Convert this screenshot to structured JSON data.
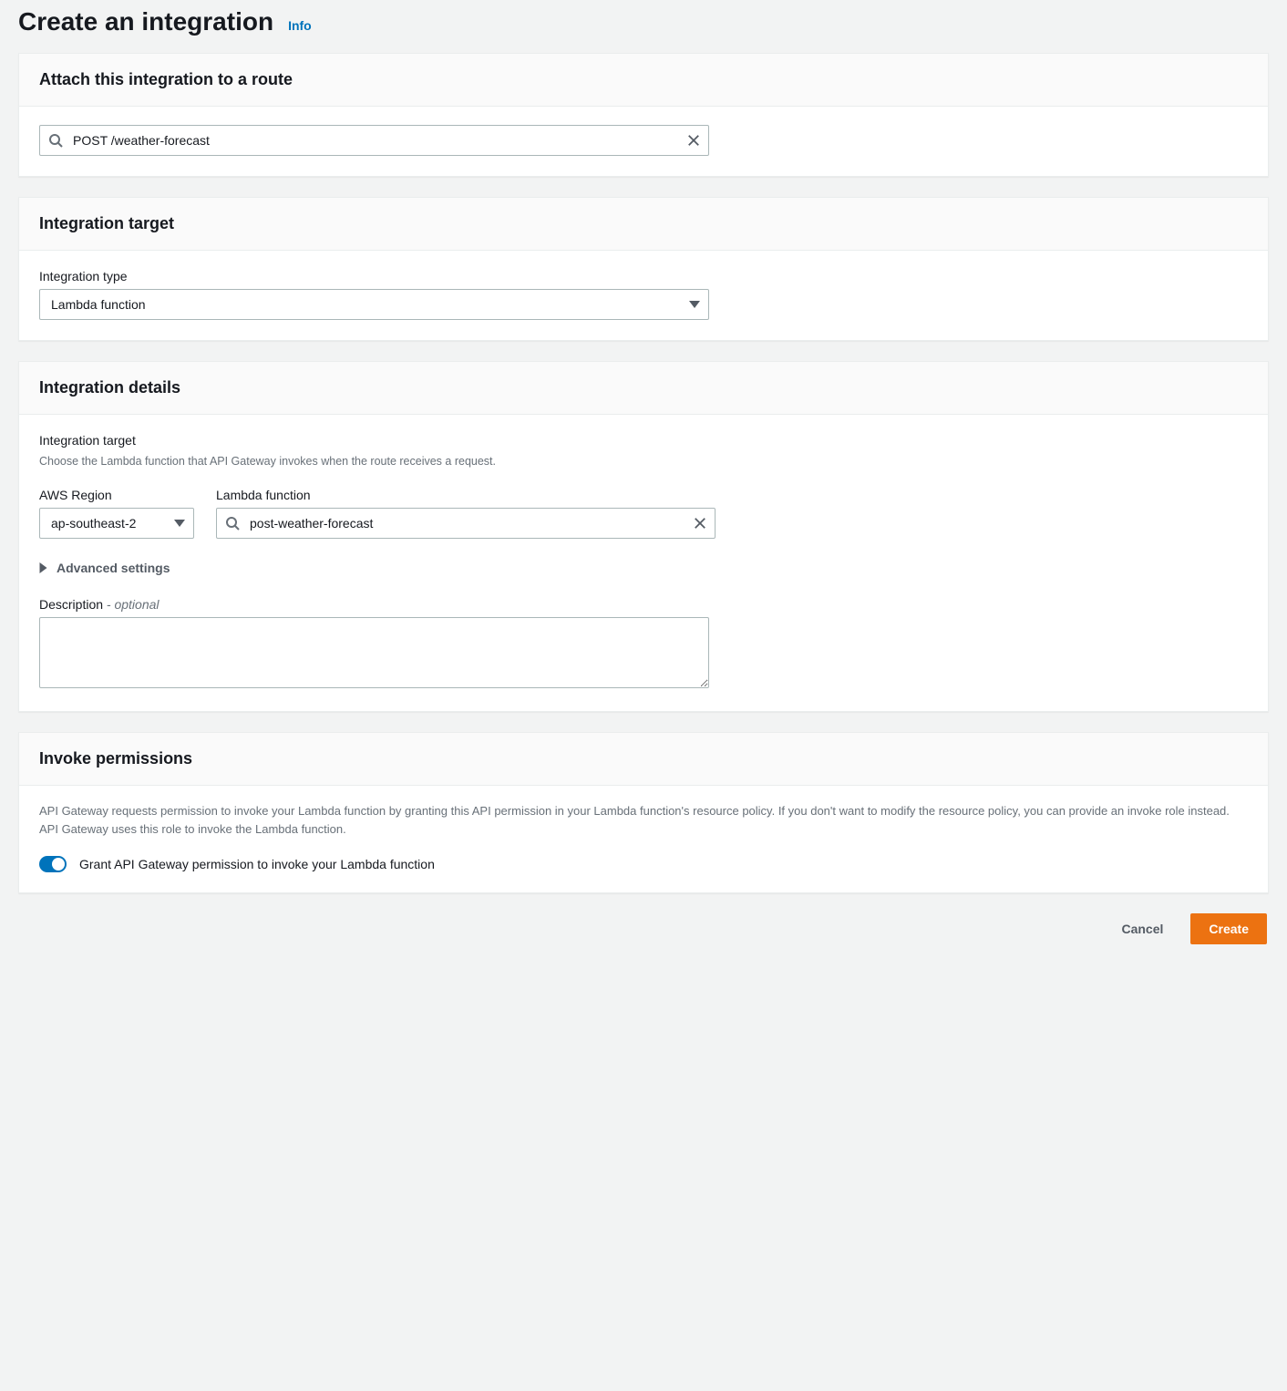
{
  "header": {
    "title": "Create an integration",
    "info_label": "Info"
  },
  "attach_panel": {
    "title": "Attach this integration to a route",
    "route_value": "POST /weather-forecast"
  },
  "target_panel": {
    "title": "Integration target",
    "type_label": "Integration type",
    "type_value": "Lambda function"
  },
  "details_panel": {
    "title": "Integration details",
    "target_label": "Integration target",
    "target_hint": "Choose the Lambda function that API Gateway invokes when the route receives a request.",
    "region_label": "AWS Region",
    "region_value": "ap-southeast-2",
    "lambda_label": "Lambda function",
    "lambda_value": "post-weather-forecast",
    "advanced_label": "Advanced settings",
    "description_label": "Description",
    "description_optional": " - optional",
    "description_value": ""
  },
  "permissions_panel": {
    "title": "Invoke permissions",
    "body_text": "API Gateway requests permission to invoke your Lambda function by granting this API permission in your Lambda function's resource policy. If you don't want to modify the resource policy, you can provide an invoke role instead. API Gateway uses this role to invoke the Lambda function.",
    "toggle_label": "Grant API Gateway permission to invoke your Lambda function",
    "toggle_on": true
  },
  "footer": {
    "cancel_label": "Cancel",
    "create_label": "Create"
  }
}
